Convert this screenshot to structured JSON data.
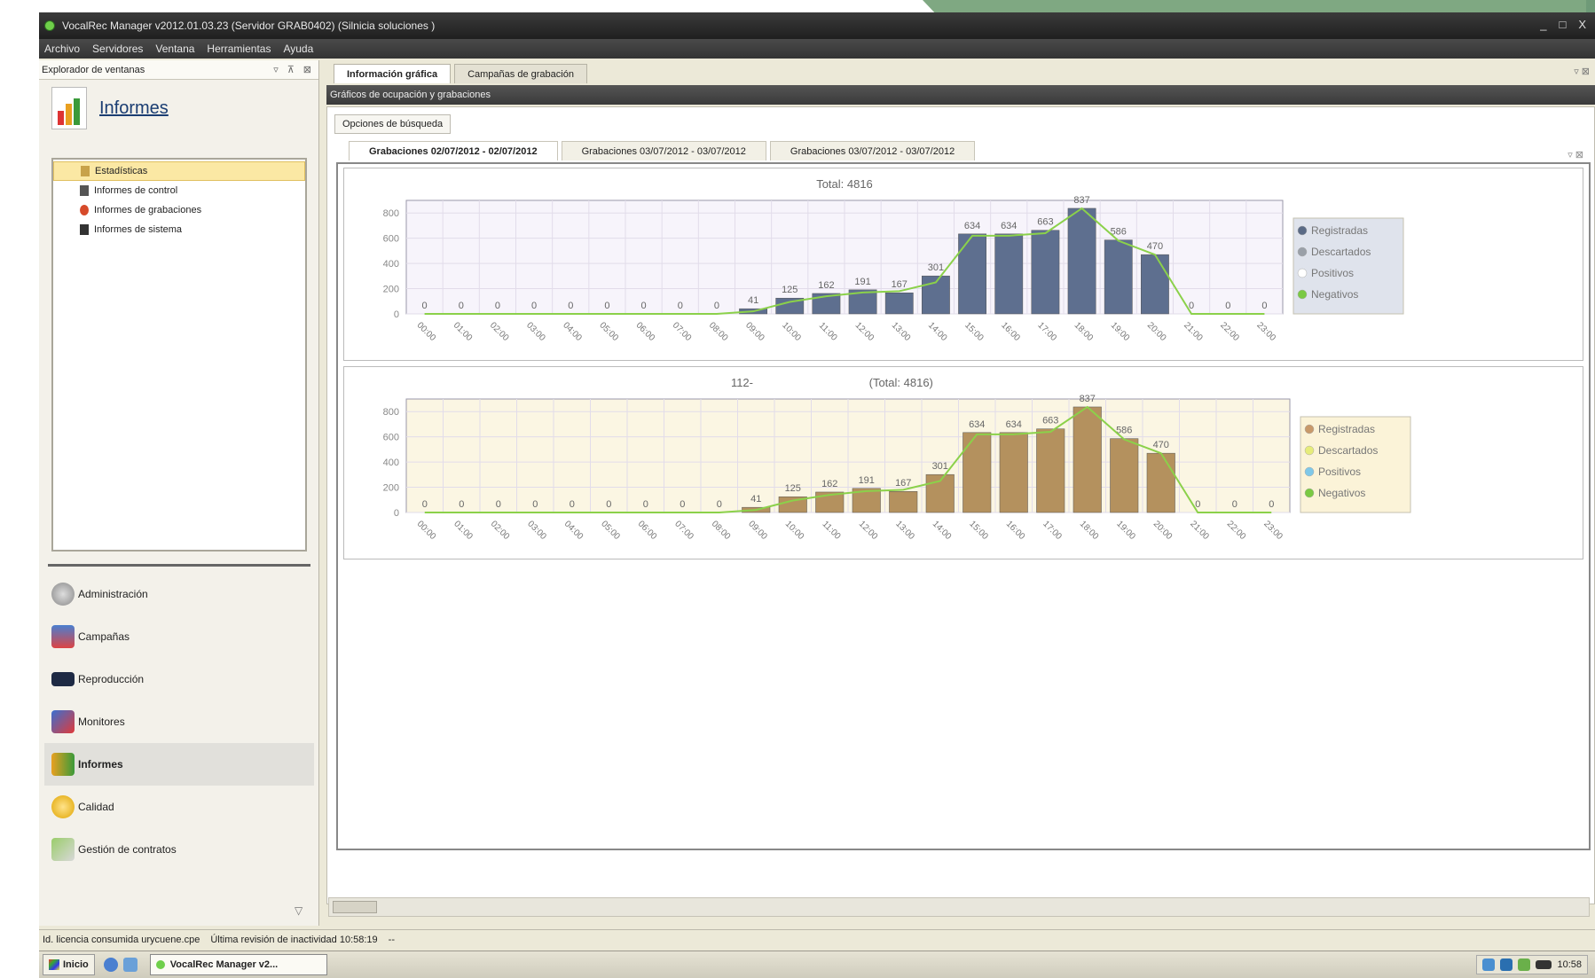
{
  "window": {
    "title": "VocalRec Manager v2012.01.03.23 (Servidor GRAB0402) (Silnicia soluciones )",
    "controls": [
      "_",
      "□",
      "X"
    ]
  },
  "menu": [
    "Archivo",
    "Servidores",
    "Ventana",
    "Herramientas",
    "Ayuda"
  ],
  "sidebar": {
    "header": "Explorador de ventanas",
    "section_title": "Informes",
    "tree": [
      {
        "label": "Estadísticas",
        "selected": true
      },
      {
        "label": "Informes de control"
      },
      {
        "label": "Informes de grabaciones"
      },
      {
        "label": "Informes de sistema"
      }
    ],
    "nav": [
      {
        "label": "Administración"
      },
      {
        "label": "Campañas"
      },
      {
        "label": "Reproducción"
      },
      {
        "label": "Monitores"
      },
      {
        "label": "Informes",
        "active": true
      },
      {
        "label": "Calidad"
      },
      {
        "label": "Gestión de contratos"
      }
    ]
  },
  "tabs": [
    {
      "label": "Información gráfica",
      "active": true
    },
    {
      "label": "Campañas de grabación"
    }
  ],
  "panel": {
    "title": "Gráficos de ocupación y grabaciones",
    "search_button": "Opciones de búsqueda",
    "subtabs": [
      {
        "label": "Grabaciones 02/07/2012 - 02/07/2012",
        "active": true
      },
      {
        "label": "Grabaciones 03/07/2012 - 03/07/2012"
      },
      {
        "label": "Grabaciones 03/07/2012 - 03/07/2012"
      }
    ]
  },
  "chart_data": [
    {
      "type": "bar",
      "title": "Total: 4816",
      "categories": [
        "00:00",
        "01:00",
        "02:00",
        "03:00",
        "04:00",
        "05:00",
        "06:00",
        "07:00",
        "08:00",
        "09:00",
        "10:00",
        "11:00",
        "12:00",
        "13:00",
        "14:00",
        "15:00",
        "16:00",
        "17:00",
        "18:00",
        "19:00",
        "20:00",
        "21:00",
        "22:00",
        "23:00"
      ],
      "values": [
        0,
        0,
        0,
        0,
        0,
        0,
        0,
        0,
        0,
        41,
        125,
        162,
        191,
        167,
        301,
        634,
        634,
        663,
        837,
        586,
        470,
        0,
        0,
        0
      ],
      "line_values": [
        0,
        0,
        0,
        0,
        0,
        0,
        0,
        0,
        0,
        20,
        95,
        140,
        170,
        180,
        250,
        620,
        620,
        640,
        837,
        580,
        470,
        0,
        0,
        0
      ],
      "ylim": [
        0,
        900
      ],
      "yticks": [
        0,
        200,
        400,
        600,
        800
      ],
      "legend": [
        "Registradas",
        "Descartados",
        "Positivos",
        "Negativos"
      ],
      "legend_colors": [
        "#5a6a85",
        "#9aa0a8",
        "#ffffff",
        "#7ac943"
      ],
      "bar_color": "#5e6f8f",
      "plot_bg": "#f7f4fb",
      "grid": true,
      "legend_position": "right"
    },
    {
      "type": "bar",
      "title_left": "112-",
      "title_right": "(Total: 4816)",
      "categories": [
        "00:00",
        "01:00",
        "02:00",
        "03:00",
        "04:00",
        "05:00",
        "06:00",
        "07:00",
        "08:00",
        "09:00",
        "10:00",
        "11:00",
        "12:00",
        "13:00",
        "14:00",
        "15:00",
        "16:00",
        "17:00",
        "18:00",
        "19:00",
        "20:00",
        "21:00",
        "22:00",
        "23:00"
      ],
      "values": [
        0,
        0,
        0,
        0,
        0,
        0,
        0,
        0,
        0,
        41,
        125,
        162,
        191,
        167,
        301,
        634,
        634,
        663,
        837,
        586,
        470,
        0,
        0,
        0
      ],
      "line_values": [
        0,
        0,
        0,
        0,
        0,
        0,
        0,
        0,
        0,
        20,
        95,
        140,
        170,
        180,
        250,
        620,
        620,
        640,
        837,
        580,
        470,
        0,
        0,
        0
      ],
      "ylim": [
        0,
        900
      ],
      "yticks": [
        0,
        200,
        400,
        600,
        800
      ],
      "legend": [
        "Registradas",
        "Descartados",
        "Positivos",
        "Negativos"
      ],
      "legend_colors": [
        "#c8996a",
        "#e6ec7a",
        "#7fc8e8",
        "#7ac943"
      ],
      "bar_color": "#b4915e",
      "plot_bg": "#fbf6e3",
      "grid": true,
      "legend_position": "right"
    }
  ],
  "statusbar": {
    "license": "Id. licencia consumida urycuene.cpe",
    "last_review": "Última revisión de inactividad 10:58:19",
    "extra": "--"
  },
  "taskbar": {
    "start": "Inicio",
    "task": "VocalRec Manager v2...",
    "clock": "10:58"
  }
}
